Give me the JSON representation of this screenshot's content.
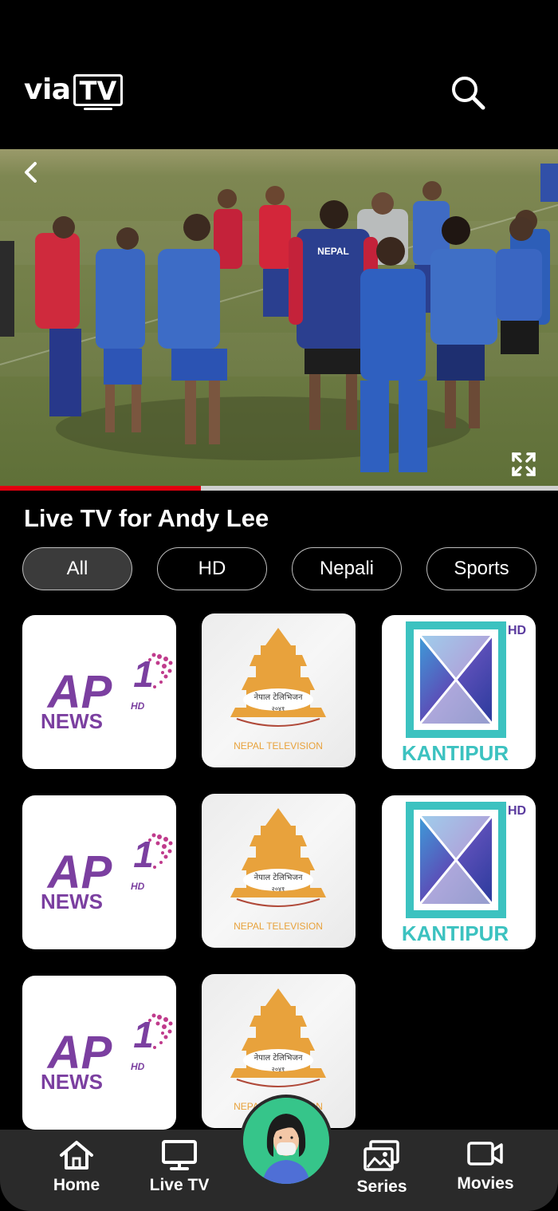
{
  "app": {
    "logo_prefix": "via",
    "logo_suffix": "TV"
  },
  "icons": {
    "search": "search-icon",
    "back": "chevron-left-icon",
    "fullscreen": "fullscreen-icon",
    "home": "home-icon",
    "live_tv": "monitor-icon",
    "series": "images-icon",
    "movies": "video-camera-icon"
  },
  "player": {
    "jersey_text": "NEPAL",
    "progress_fraction": 0.36
  },
  "section": {
    "title": "Live TV for Andy Lee"
  },
  "filters": [
    {
      "label": "All",
      "active": true
    },
    {
      "label": "HD",
      "active": false
    },
    {
      "label": "Nepali",
      "active": false
    },
    {
      "label": "Sports",
      "active": false
    }
  ],
  "channels": [
    {
      "name": "AP1 HD News",
      "logo_main": "AP",
      "logo_number": "1",
      "logo_hd": "HD",
      "logo_sub": "NEWS"
    },
    {
      "name": "Nepal Television",
      "logo_script": "नेपाल टेलिभिजन",
      "logo_year": "२०४१",
      "logo_sub": "NEPAL TELEVISION"
    },
    {
      "name": "Kantipur HD",
      "logo_hd": "HD",
      "logo_sub": "KANTIPUR"
    },
    {
      "name": "AP1 HD News",
      "logo_main": "AP",
      "logo_number": "1",
      "logo_hd": "HD",
      "logo_sub": "NEWS"
    },
    {
      "name": "Nepal Television",
      "logo_script": "नेपाल टेलिभिजन",
      "logo_year": "२०४१",
      "logo_sub": "NEPAL TELEVISION"
    },
    {
      "name": "Kantipur HD",
      "logo_hd": "HD",
      "logo_sub": "KANTIPUR"
    },
    {
      "name": "AP1 HD News",
      "logo_main": "AP",
      "logo_number": "1",
      "logo_hd": "HD",
      "logo_sub": "NEWS"
    },
    {
      "name": "Nepal Television",
      "logo_script": "नेपाल टेलिभिजन",
      "logo_year": "२०४१",
      "logo_sub": "NEPAL TELEVISION"
    }
  ],
  "nav": {
    "home": "Home",
    "live_tv": "Live TV",
    "series": "Series",
    "movies": "Movies"
  },
  "colors": {
    "accent": "#e3000f",
    "avatar_bg": "#36c58a",
    "ap1_purple": "#7b3fa0",
    "ntv_orange": "#e8a23c",
    "kantipur_teal": "#3cc2c0"
  }
}
